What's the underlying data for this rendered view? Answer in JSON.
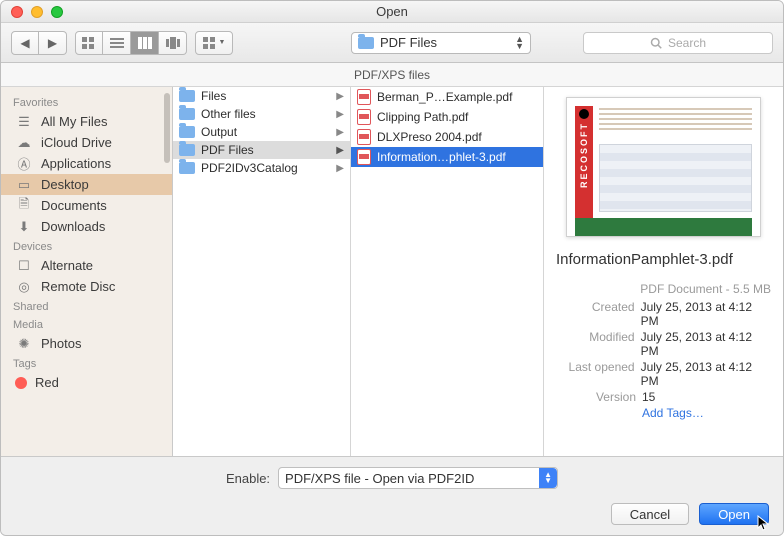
{
  "window": {
    "title": "Open"
  },
  "toolbar": {
    "path_label": "PDF Files",
    "search_placeholder": "Search"
  },
  "subheader": "PDF/XPS files",
  "sidebar": {
    "sections": {
      "favorites": "Favorites",
      "devices": "Devices",
      "shared": "Shared",
      "media": "Media",
      "tags": "Tags"
    },
    "favorites": [
      {
        "label": "All My Files"
      },
      {
        "label": "iCloud Drive"
      },
      {
        "label": "Applications"
      },
      {
        "label": "Desktop",
        "selected": true
      },
      {
        "label": "Documents"
      },
      {
        "label": "Downloads"
      }
    ],
    "devices": [
      {
        "label": "Alternate"
      },
      {
        "label": "Remote Disc"
      }
    ],
    "media": [
      {
        "label": "Photos"
      }
    ],
    "tags": [
      {
        "label": "Red",
        "color": "#ff5d55"
      }
    ]
  },
  "col1": [
    {
      "label": "Files"
    },
    {
      "label": "Other files"
    },
    {
      "label": "Output"
    },
    {
      "label": "PDF Files",
      "selected": true
    },
    {
      "label": "PDF2IDv3Catalog"
    }
  ],
  "col2": [
    {
      "label": "Berman_P…Example.pdf"
    },
    {
      "label": "Clipping Path.pdf"
    },
    {
      "label": "DLXPreso 2004.pdf"
    },
    {
      "label": "Information…phlet-3.pdf",
      "selected": true
    }
  ],
  "preview": {
    "filename": "InformationPamphlet-3.pdf",
    "doc_type": "PDF Document - 5.5 MB",
    "created_label": "Created",
    "created": "July 25, 2013 at 4:12 PM",
    "modified_label": "Modified",
    "modified": "July 25, 2013 at 4:12 PM",
    "lastopened_label": "Last opened",
    "lastopened": "July 25, 2013 at 4:12 PM",
    "version_label": "Version",
    "version": "15",
    "add_tags": "Add Tags…",
    "band_text": "RECOSOFT"
  },
  "footer": {
    "enable_label": "Enable:",
    "enable_value": "PDF/XPS file - Open via PDF2ID",
    "cancel": "Cancel",
    "open": "Open"
  }
}
